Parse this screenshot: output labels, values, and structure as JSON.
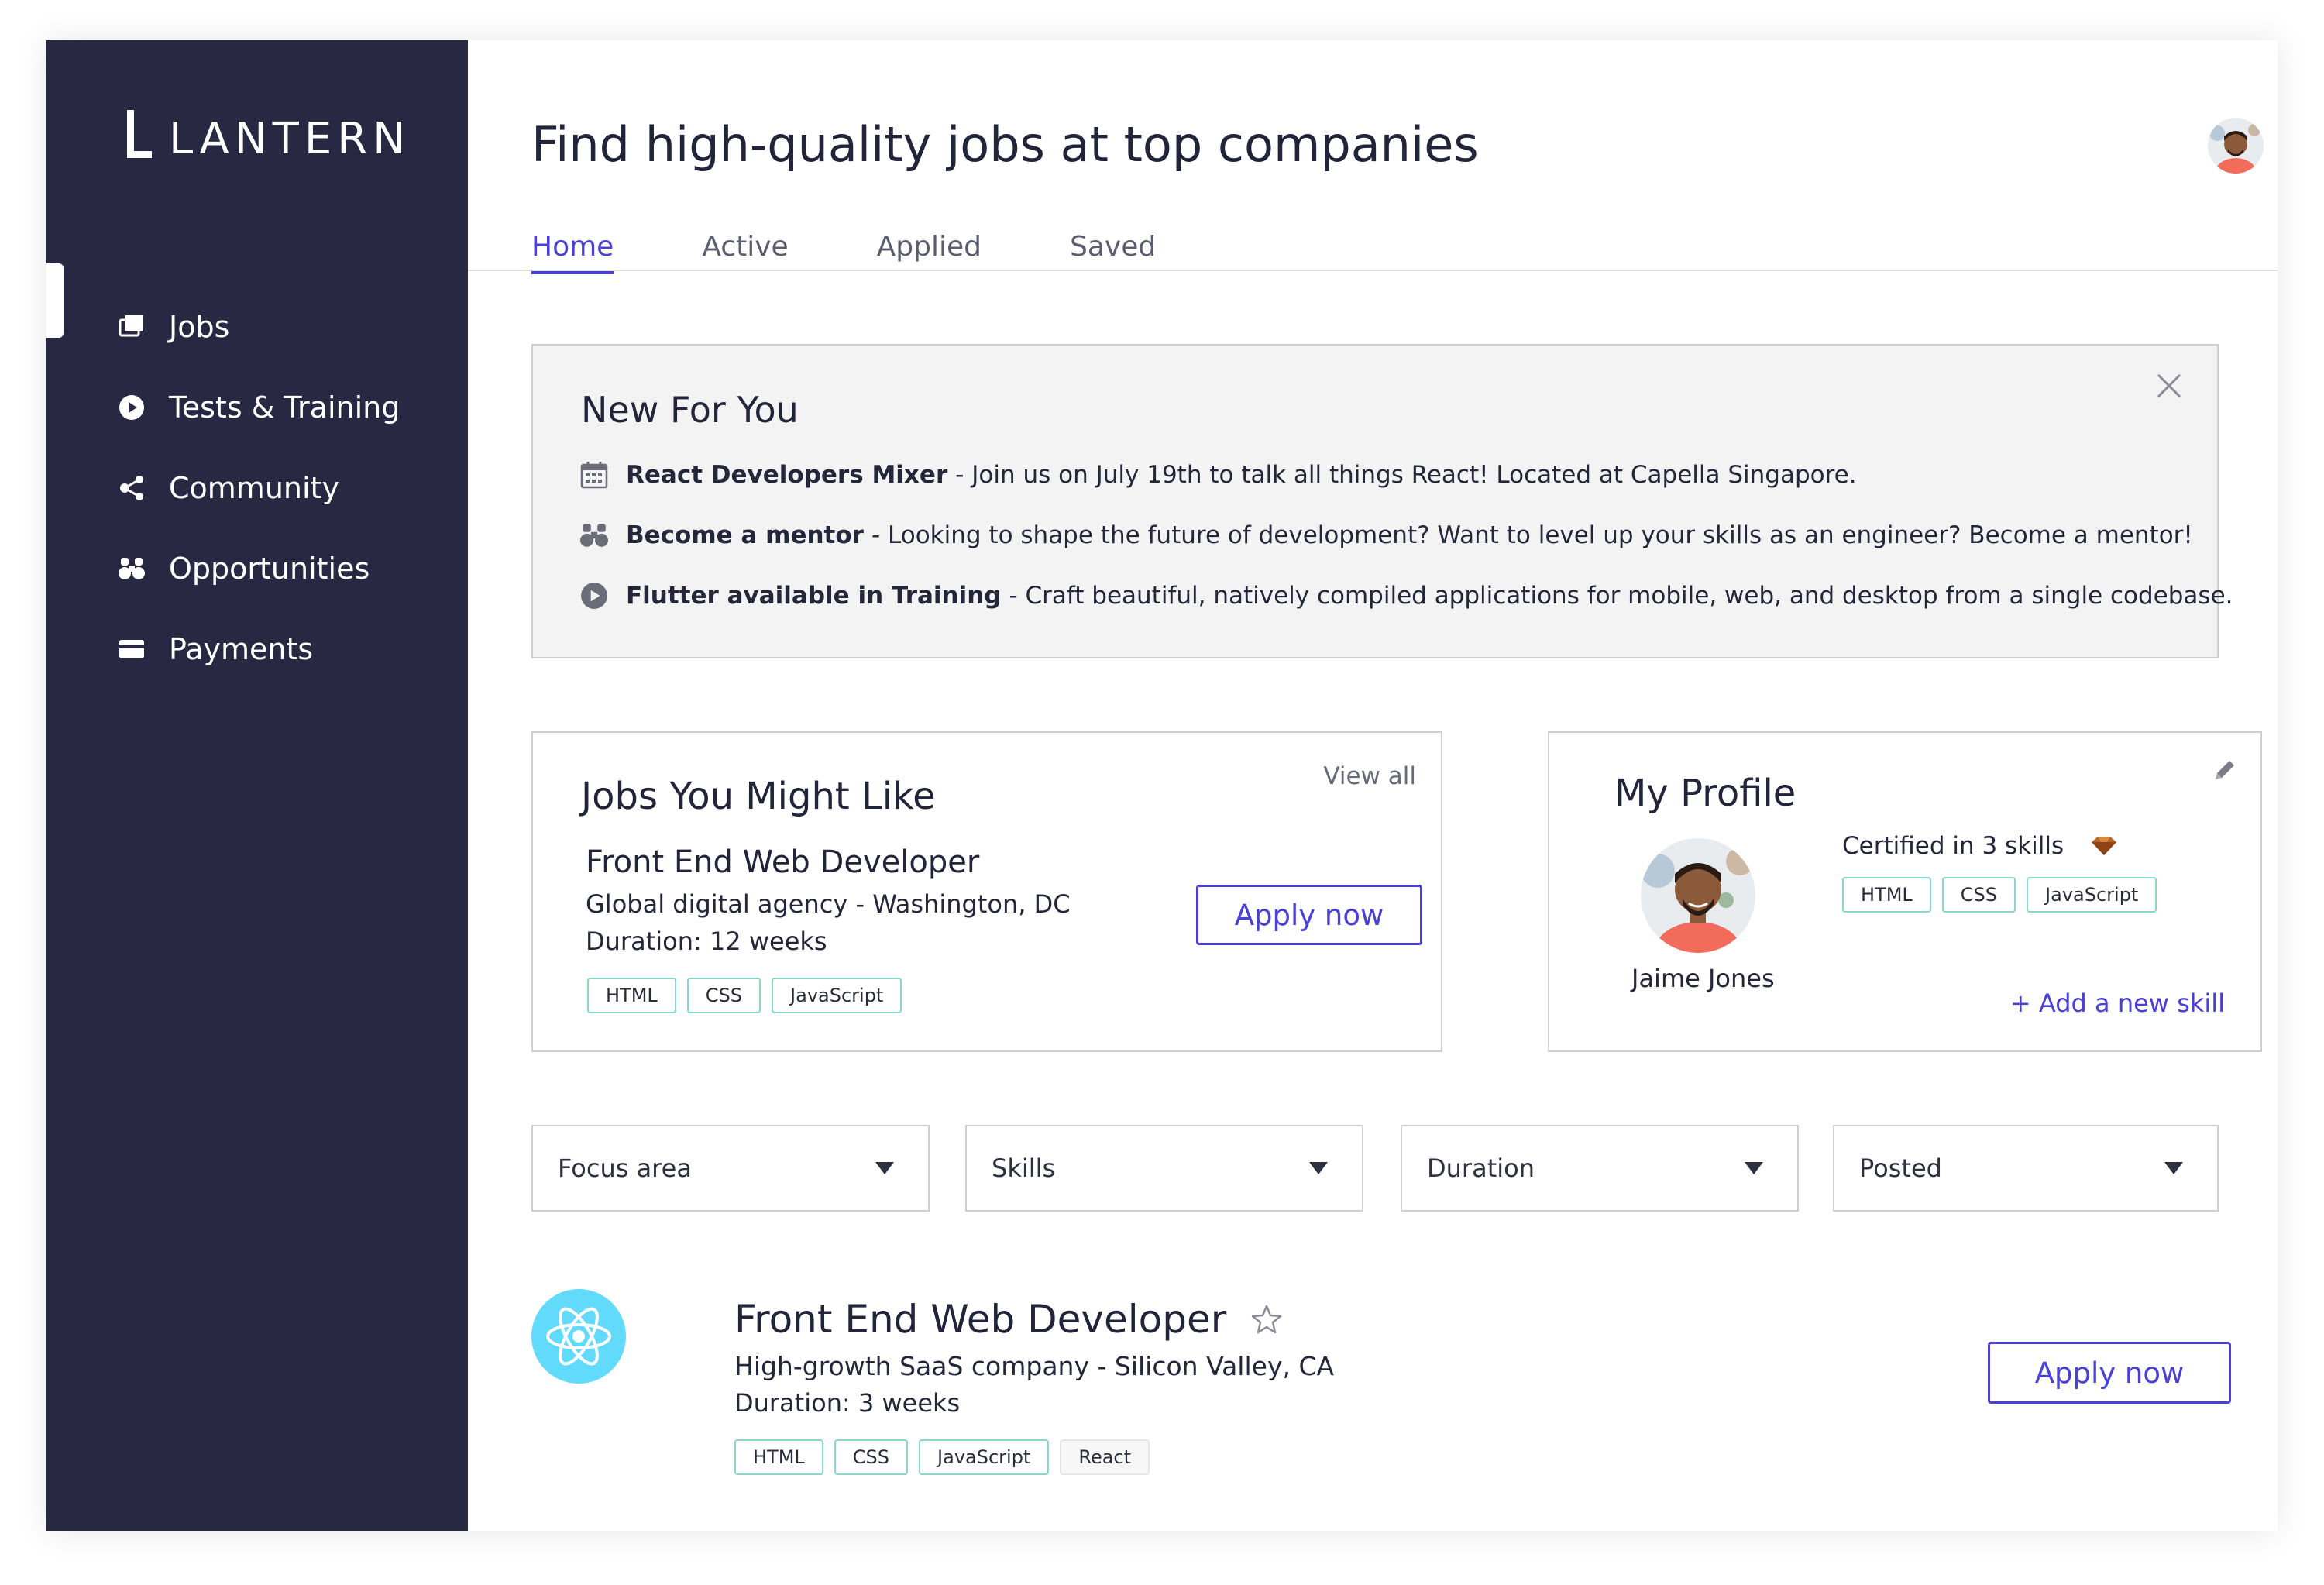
{
  "brand": {
    "name": "LANTERN"
  },
  "sidebar": {
    "items": [
      {
        "label": "Jobs",
        "icon": "jobs-icon"
      },
      {
        "label": "Tests & Training",
        "icon": "play-circle-icon"
      },
      {
        "label": "Community",
        "icon": "share-icon"
      },
      {
        "label": "Opportunities",
        "icon": "binoculars-icon"
      },
      {
        "label": "Payments",
        "icon": "credit-card-icon"
      }
    ],
    "active_index": 0
  },
  "header": {
    "title": "Find high-quality jobs at top companies",
    "tabs": [
      {
        "label": "Home"
      },
      {
        "label": "Active"
      },
      {
        "label": "Applied"
      },
      {
        "label": "Saved"
      }
    ],
    "active_tab": 0
  },
  "news": {
    "title": "New For You",
    "items": [
      {
        "icon": "calendar-icon",
        "bold": "React Developers Mixer",
        "text": "- Join us on July 19th to talk all things React! Located at Capella Singapore."
      },
      {
        "icon": "binoculars-icon",
        "bold": "Become a mentor",
        "text": "- Looking to shape the future of development? Want to level up your skills as an engineer? Become a mentor!"
      },
      {
        "icon": "play-circle-icon",
        "bold": "Flutter available in Training",
        "text": "- Craft beautiful, natively compiled applications for mobile, web, and desktop from a single codebase."
      }
    ]
  },
  "jobs_card": {
    "title": "Jobs You Might Like",
    "view_all": "View all",
    "job": {
      "title": "Front End Web Developer",
      "company": "Global digital agency - Washington, DC",
      "duration": "Duration: 12 weeks",
      "tags": [
        "HTML",
        "CSS",
        "JavaScript"
      ],
      "apply": "Apply now"
    }
  },
  "profile": {
    "title": "My Profile",
    "name": "Jaime Jones",
    "certified": "Certified in 3 skills",
    "skills": [
      "HTML",
      "CSS",
      "JavaScript"
    ],
    "add_skill": "+ Add a new skill"
  },
  "filters": [
    {
      "label": "Focus area"
    },
    {
      "label": "Skills"
    },
    {
      "label": "Duration"
    },
    {
      "label": "Posted"
    }
  ],
  "listing": {
    "title": "Front End Web Developer",
    "company": "High-growth SaaS company - Silicon Valley, CA",
    "duration": "Duration: 3 weeks",
    "tags": [
      "HTML",
      "CSS",
      "JavaScript"
    ],
    "extra_tag": "React",
    "apply": "Apply now"
  },
  "colors": {
    "sidebar_bg": "#282843",
    "accent": "#4a3fd6",
    "tag_border": "#86d8c9",
    "react_blue": "#61dafb"
  }
}
